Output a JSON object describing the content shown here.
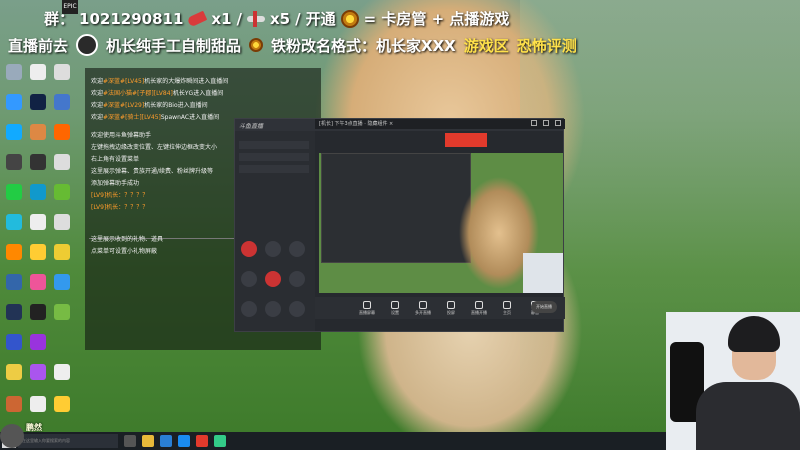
{
  "banner": {
    "fan_group_prefix": "群：",
    "fan_group_number": "1021290811",
    "rocket_count": "x1",
    "plane_count": "x5",
    "open_label": "开通",
    "badge_rule": "= 卡房管 + 点播游戏",
    "slogan_part1": "直播前去",
    "slogan_part2": "机长纯手工自制甜品",
    "slogan_part3": "铁粉改名格式：机长家XXX",
    "slogan_part4": "游戏区",
    "slogan_part5": "恐怖评测"
  },
  "chat": {
    "lines": [
      {
        "prefix": "欢迎",
        "tag": "#深蓝#",
        "level": "[LV45]",
        "text": "机长家的大爆炸瞬间进入直播间"
      },
      {
        "prefix": "欢迎",
        "tag": "#法国小猫#",
        "level": "[子郡]",
        "lv2": "[LV84]",
        "text": "机长YG进入直播间"
      },
      {
        "prefix": "欢迎",
        "tag": "#深蓝#",
        "level": "[LV29]",
        "text": "机长家的Bio进入直播间"
      },
      {
        "prefix": "欢迎",
        "tag": "#深蓝#",
        "level": "[骑士]",
        "lv2": "[LV45]",
        "text": "SpawnAC进入直播间"
      }
    ],
    "help": [
      "欢迎使用斗鱼弹幕助手",
      "左键拖拽边缘改变位置、左键拉伸边框改变大小",
      "右上角有设置菜单",
      "这里展示弹幕、贵族开通/续费、粉丝牌升级等",
      "添加弹幕助手成功"
    ],
    "danmu": [
      {
        "level": "[LV9]",
        "text": "机长：？？？？"
      },
      {
        "level": "[LV9]",
        "text": "机长：？？？？"
      }
    ],
    "gift_help": [
      "这里展示收到的礼物、道具",
      "点菜单可设置小礼物屏蔽"
    ]
  },
  "stream_window": {
    "logo": "斗鱼直播",
    "tab_title": "[机长] 下午3点直播 · 隐藏组件 ×",
    "toolbar": [
      "直播屏幕",
      "设置",
      "多开直播",
      "投屏",
      "直播开播",
      "主页",
      "静音"
    ],
    "start_label": "开始直播"
  },
  "taskbar": {
    "search_placeholder": "在这里输入你要搜索的内容"
  },
  "corner": {
    "name": "鹏然"
  },
  "colors": {
    "accent_orange": "#ff9d2b",
    "accent_red": "#e23a2c",
    "banner_yellow": "#ffe14a"
  }
}
